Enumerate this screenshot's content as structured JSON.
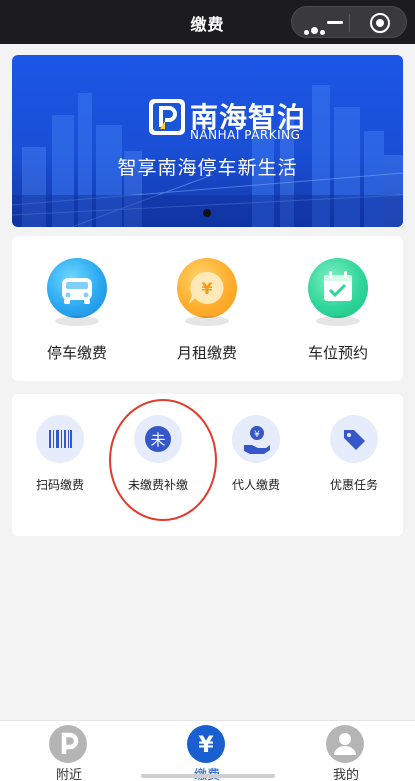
{
  "navbar": {
    "title": "缴费",
    "capsule": {
      "more_icon": "more-dots-icon",
      "minimize_icon": "minus-icon",
      "close_icon": "target-circle-icon"
    }
  },
  "banner": {
    "brand_cn": "南海智泊",
    "brand_en": "NANHAI PARKING",
    "slogan": "智享南海停车新生活",
    "logo_icon": "p-parking-icon",
    "carousel_current": 1,
    "carousel_total": 1
  },
  "main_services": [
    {
      "label": "停车缴费",
      "icon": "car-icon",
      "color": "#2aa8f0"
    },
    {
      "label": "月租缴费",
      "icon": "yuan-coin-icon",
      "color": "#ffae2e"
    },
    {
      "label": "车位预约",
      "icon": "calendar-check-icon",
      "color": "#30d69a"
    }
  ],
  "secondary_services": [
    {
      "label": "扫码缴费",
      "icon": "barcode-icon"
    },
    {
      "label": "未缴费补缴",
      "icon": "wei-badge-icon",
      "glyph": "未"
    },
    {
      "label": "代人缴费",
      "icon": "hand-yuan-icon"
    },
    {
      "label": "优惠任务",
      "icon": "tag-icon"
    }
  ],
  "tabbar": {
    "items": [
      {
        "label": "附近",
        "icon": "p-parking-icon",
        "active": false
      },
      {
        "label": "缴费",
        "icon": "yuan-icon",
        "active": true,
        "glyph": "¥"
      },
      {
        "label": "我的",
        "icon": "user-icon",
        "active": false
      }
    ]
  },
  "colors": {
    "accent": "#1a5fd0",
    "icon_bg": "#e6ecfb",
    "highlight_ring": "#e33b2b",
    "navbar_bg": "#1c1c1e"
  }
}
